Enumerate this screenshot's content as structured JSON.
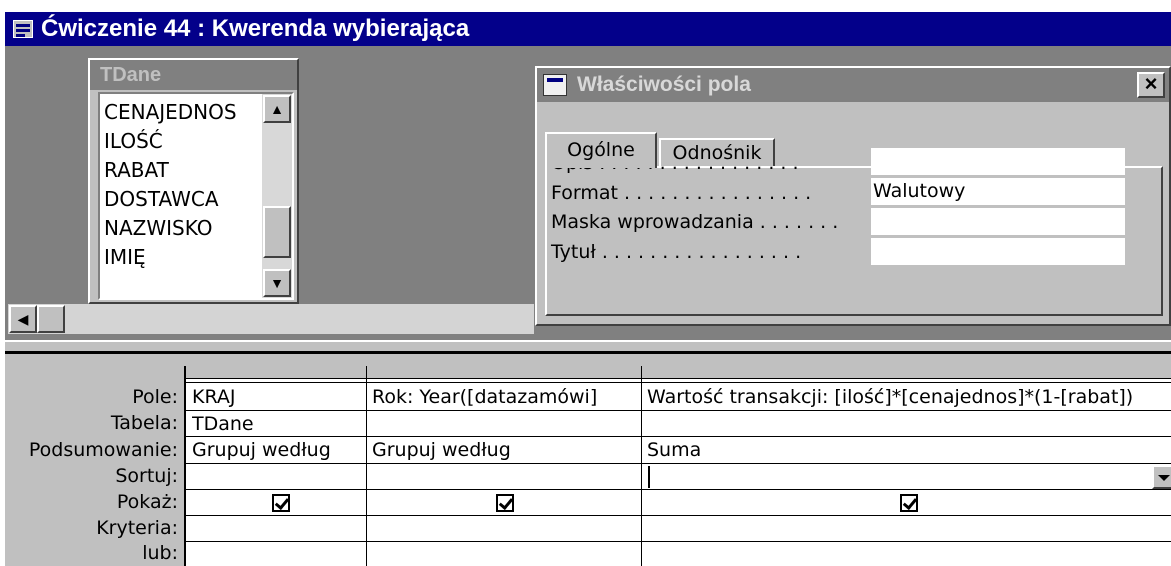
{
  "window": {
    "title": "Ćwiczenie 44 : Kwerenda wybierająca"
  },
  "table_list": {
    "title": "TDane",
    "fields": [
      "CENAJEDNOS",
      "ILOŚĆ",
      "RABAT",
      "DOSTAWCA",
      "NAZWISKO",
      "IMIĘ"
    ]
  },
  "properties": {
    "title": "Właściwości pola",
    "close_glyph": "×",
    "tabs": [
      {
        "label": "Ogólne"
      },
      {
        "label": "Odnośnik"
      }
    ],
    "rows": [
      {
        "label": "Opis . . . . . . . . . . . . . . . . .",
        "value": ""
      },
      {
        "label": "Format . . . . . . . . . . . . . . . .",
        "value": "Walutowy"
      },
      {
        "label": "Maska wprowadzania . . . . . . .",
        "value": ""
      },
      {
        "label": "Tytuł . . . . . . . . . . . . . . . . .",
        "value": ""
      }
    ]
  },
  "grid": {
    "row_labels": [
      "Pole:",
      "Tabela:",
      "Podsumowanie:",
      "Sortuj:",
      "Pokaż:",
      "Kryteria:",
      "lub:"
    ],
    "columns": [
      {
        "pole": "KRAJ",
        "tabela": "TDane",
        "podsumowanie": "Grupuj według",
        "sortuj": "",
        "pokaz": true
      },
      {
        "pole": "Rok: Year([datazamówi]",
        "tabela": "",
        "podsumowanie": "Grupuj według",
        "sortuj": "",
        "pokaz": true
      },
      {
        "pole": "Wartość transakcji: [ilość]*[cenajednos]*(1-[rabat])",
        "tabela": "",
        "podsumowanie": "Suma",
        "sortuj": "",
        "pokaz": true
      }
    ]
  }
}
